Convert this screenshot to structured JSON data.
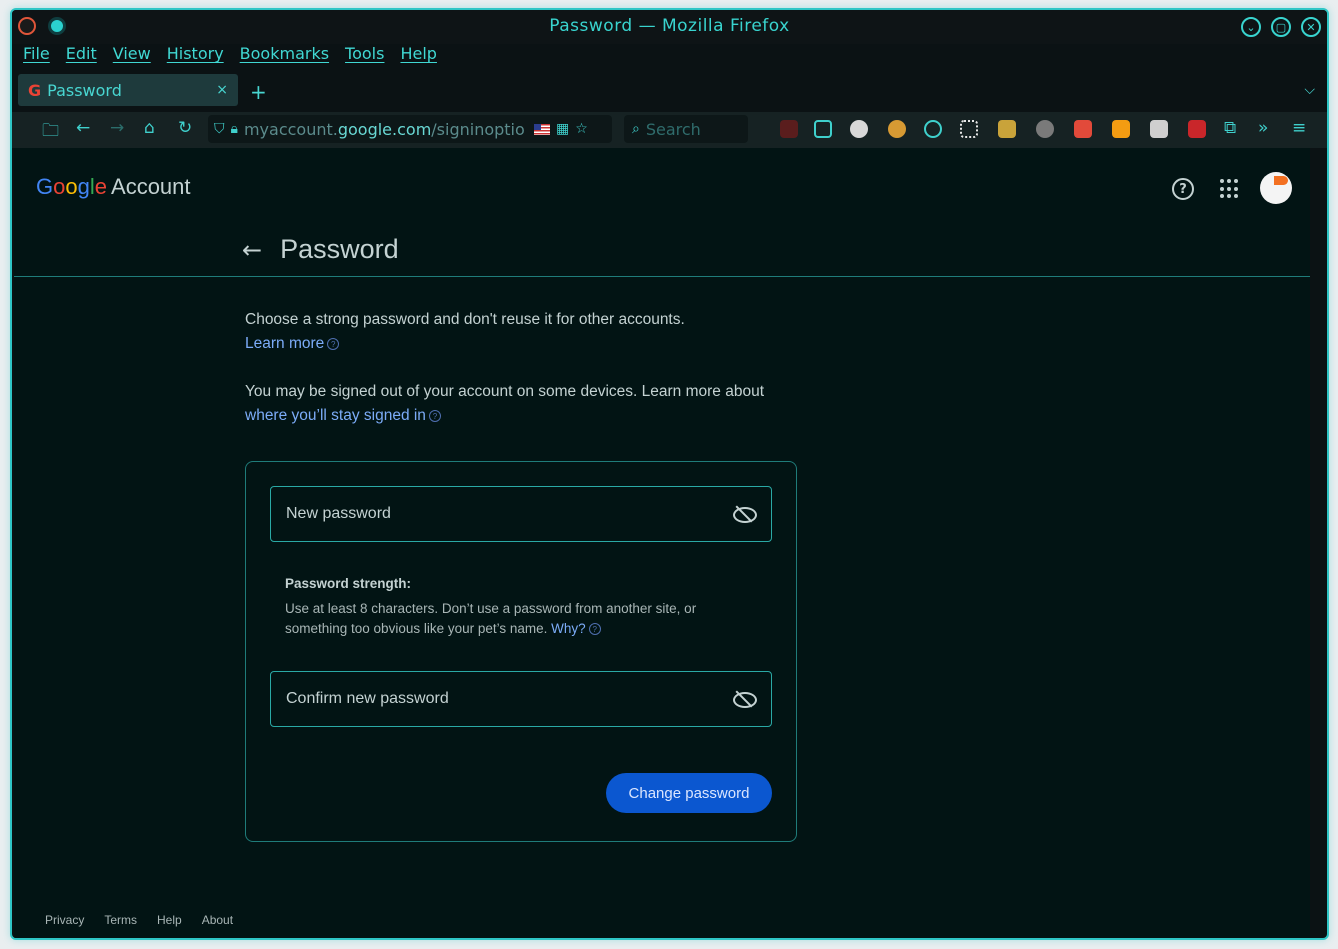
{
  "window": {
    "title": "Password — Mozilla Firefox"
  },
  "menu": [
    "File",
    "Edit",
    "View",
    "History",
    "Bookmarks",
    "Tools",
    "Help"
  ],
  "tab": {
    "title": "Password",
    "favicon": "G",
    "close": "×"
  },
  "new_tab": "+",
  "tab_list": "⌵",
  "url": {
    "prefix": "myaccount.",
    "host": "google.com",
    "path": "/signinoptio"
  },
  "search": {
    "placeholder": "Search"
  },
  "logo": {
    "g1": "G",
    "g2": "o",
    "g3": "o",
    "g4": "g",
    "g5": "l",
    "g6": "e",
    "account": "Account"
  },
  "header": {
    "back": "←",
    "title": "Password"
  },
  "info": {
    "p1": "Choose a strong password and don't reuse it for other accounts.",
    "p1_link": "Learn more",
    "p2": "You may be signed out of your account on some devices. Learn more about",
    "p2_link": "where you’ll stay signed in"
  },
  "form": {
    "new_password_placeholder": "New password",
    "strength_title": "Password strength:",
    "strength_body": "Use at least 8 characters. Don’t use a password from another site, or something too obvious like your pet’s name.",
    "why_link": "Why?",
    "confirm_placeholder": "Confirm new password",
    "submit": "Change password"
  },
  "footer": [
    "Privacy",
    "Terms",
    "Help",
    "About"
  ],
  "colors": {
    "accent": "#2fc6c6",
    "link": "#7cacf8",
    "primary_button": "#0b57d0",
    "page_bg": "#021414"
  }
}
